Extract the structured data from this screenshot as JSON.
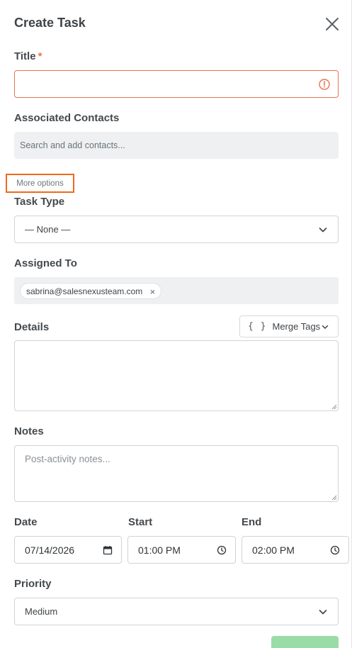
{
  "header": {
    "title": "Create Task"
  },
  "title_field": {
    "label": "Title",
    "required_mark": "*",
    "value": ""
  },
  "contacts": {
    "label": "Associated Contacts",
    "placeholder": "Search and add contacts..."
  },
  "more_options": {
    "label": "More options"
  },
  "task_type": {
    "label": "Task Type",
    "selected": "— None —"
  },
  "assigned_to": {
    "label": "Assigned To",
    "chips": [
      "sabrina@salesnexusteam.com"
    ],
    "chip_remove": "×"
  },
  "details": {
    "label": "Details",
    "merge_tags_label": "Merge Tags",
    "merge_tags_icon": "{ }",
    "value": ""
  },
  "notes": {
    "label": "Notes",
    "placeholder": "Post-activity notes..."
  },
  "date": {
    "label": "Date",
    "value": "07/14/2026"
  },
  "start": {
    "label": "Start",
    "value": "01:00 PM"
  },
  "end": {
    "label": "End",
    "value": "02:00 PM"
  },
  "priority": {
    "label": "Priority",
    "selected": "Medium"
  },
  "colors": {
    "accent_error": "#e8734f",
    "highlight_border": "#ee6a1c",
    "primary_button": "#9bdba8",
    "field_bg": "#eef0f1"
  }
}
